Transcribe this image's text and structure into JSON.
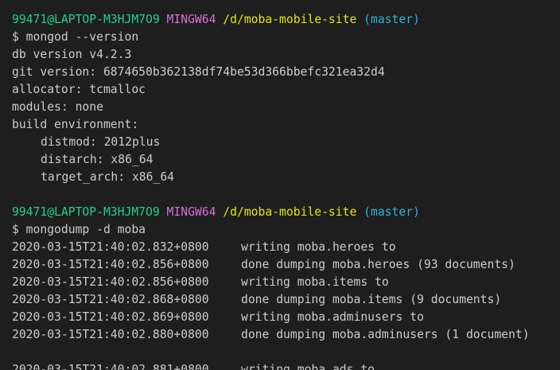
{
  "block1": {
    "prompt": {
      "user": "99471@LAPTOP-M3HJM7O9",
      "system": "MINGW64",
      "path": "/d/moba-mobile-site",
      "branch": "(master)"
    },
    "command": "$ mongod --version",
    "output": [
      "db version v4.2.3",
      "git version: 6874650b362138df74be53d366bbefc321ea32d4",
      "allocator: tcmalloc",
      "modules: none",
      "build environment:"
    ],
    "build_env": [
      "distmod: 2012plus",
      "distarch: x86_64",
      "target_arch: x86_64"
    ]
  },
  "block2": {
    "prompt": {
      "user": "99471@LAPTOP-M3HJM7O9",
      "system": "MINGW64",
      "path": "/d/moba-mobile-site",
      "branch": "(master)"
    },
    "command": "$ mongodump -d moba",
    "logs": [
      {
        "ts": "2020-03-15T21:40:02.832+0800",
        "msg": "writing moba.heroes to"
      },
      {
        "ts": "2020-03-15T21:40:02.856+0800",
        "msg": "done dumping moba.heroes (93 documents)"
      },
      {
        "ts": "2020-03-15T21:40:02.856+0800",
        "msg": "writing moba.items to"
      },
      {
        "ts": "2020-03-15T21:40:02.868+0800",
        "msg": "done dumping moba.items (9 documents)"
      },
      {
        "ts": "2020-03-15T21:40:02.869+0800",
        "msg": "writing moba.adminusers to"
      },
      {
        "ts": "2020-03-15T21:40:02.880+0800",
        "msg": "done dumping moba.adminusers (1 document)"
      }
    ],
    "partial_log": {
      "ts": "2020-03-15T21:40:02.881+0800",
      "msg": "writing moba.ads to"
    }
  },
  "colors": {
    "background": "#1e1e1e",
    "text": "#cccccc",
    "user": "#23d18b",
    "system": "#d670d6",
    "path": "#e5e510",
    "branch": "#29b8db"
  }
}
